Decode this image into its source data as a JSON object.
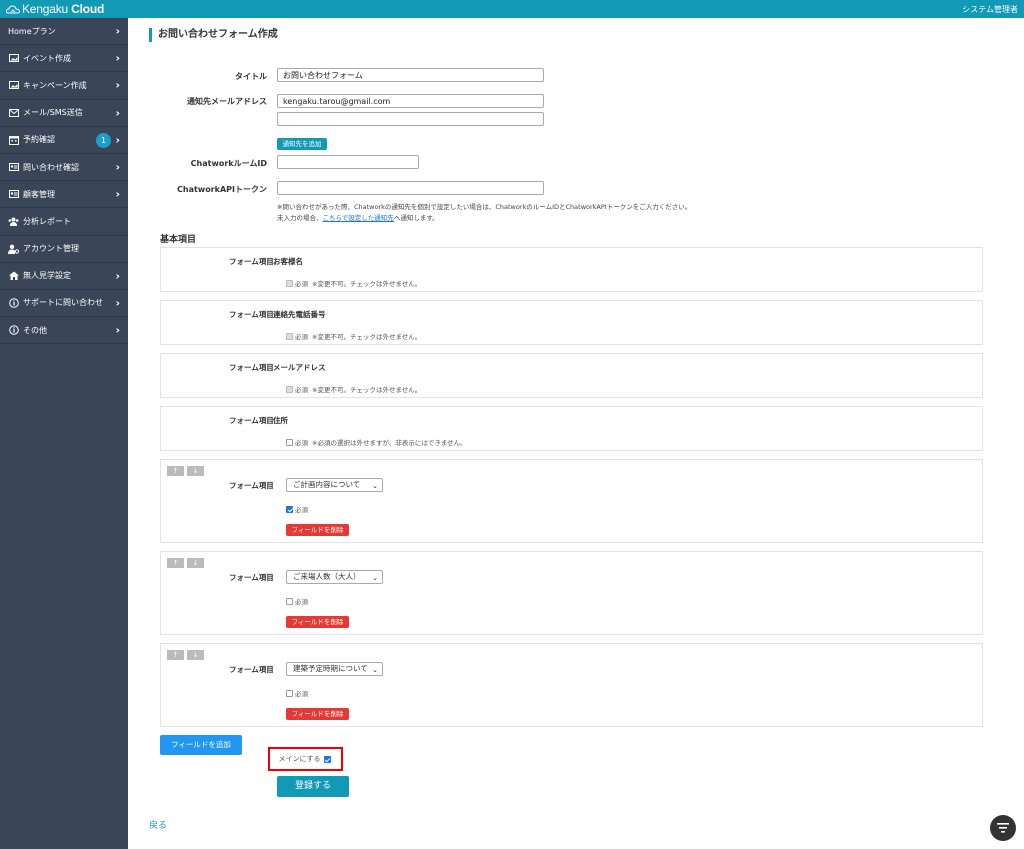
{
  "header": {
    "brand_prefix": "Kengaku",
    "brand_suffix": " Cloud",
    "admin_label": "システム管理者"
  },
  "sidebar": {
    "items": [
      {
        "label": "Homeプラン",
        "icon": "none",
        "chevron": true
      },
      {
        "label": "イベント作成",
        "icon": "image-icon",
        "chevron": true
      },
      {
        "label": "キャンペーン作成",
        "icon": "image-icon",
        "chevron": true
      },
      {
        "label": "メール/SMS送信",
        "icon": "mail-icon",
        "chevron": true
      },
      {
        "label": "予約確認",
        "icon": "calendar-icon",
        "chevron": true,
        "badge": "1"
      },
      {
        "label": "問い合わせ確認",
        "icon": "id-card-icon",
        "chevron": true
      },
      {
        "label": "顧客管理",
        "icon": "id-card-icon",
        "chevron": true
      },
      {
        "label": "分析レポート",
        "icon": "users-icon",
        "chevron": false
      },
      {
        "label": "アカウント管理",
        "icon": "user-gear-icon",
        "chevron": false
      },
      {
        "label": "無人見学設定",
        "icon": "home-icon",
        "chevron": true
      },
      {
        "label": "サポートに問い合わせ",
        "icon": "info-icon",
        "chevron": true
      },
      {
        "label": "その他",
        "icon": "info-icon",
        "chevron": true
      }
    ]
  },
  "page": {
    "title": "お問い合わせフォーム作成"
  },
  "form": {
    "title_label": "タイトル",
    "title_value": "お問い合わせフォーム",
    "email_label": "通知先メールアドレス",
    "email_value_1": "kengaku.tarou@gmail.com",
    "email_value_2": "",
    "add_email_button": "通知先を追加",
    "chatwork_room_label": "ChatworkルームID",
    "chatwork_room_value": "",
    "chatwork_token_label": "ChatworkAPIトークン",
    "chatwork_token_value": "",
    "note_line1": "※問い合わせがあった際、Chatworkの通知先を個別で設定したい場合は、ChatworkのルームIDとChatworkAPIトークンをご入力ください。",
    "note_line2_prefix": "未入力の場合、",
    "note_link": "こちらで設定した通知先",
    "note_line2_suffix": "へ通知します。"
  },
  "basic_section": {
    "label": "基本項目"
  },
  "fixed_fields": [
    {
      "label": "フォーム項目",
      "name": "お客様名",
      "required_text": "必須",
      "note": "※変更不可。チェックは外せません。"
    },
    {
      "label": "フォーム項目",
      "name": "連絡先電話番号",
      "required_text": "必須",
      "note": "※変更不可。チェックは外せません。"
    },
    {
      "label": "フォーム項目",
      "name": "メールアドレス",
      "required_text": "必須",
      "note": "※変更不可。チェックは外せません。"
    },
    {
      "label": "フォーム項目",
      "name": "住所",
      "required_text": "必須",
      "note": "※必須の選択は外せますが、非表示にはできません。"
    }
  ],
  "custom_fields": [
    {
      "label": "フォーム項目",
      "selected": "ご計画内容について",
      "required_text": "必須",
      "required": true,
      "delete_label": "フィールドを削除",
      "up": "↑",
      "down": "↓"
    },
    {
      "label": "フォーム項目",
      "selected": "ご来場人数（大人）",
      "required_text": "必須",
      "required": false,
      "delete_label": "フィールドを削除",
      "up": "↑",
      "down": "↓"
    },
    {
      "label": "フォーム項目",
      "selected": "建築予定時期について",
      "required_text": "必須",
      "required": false,
      "delete_label": "フィールドを削除",
      "up": "↑",
      "down": "↓"
    }
  ],
  "actions": {
    "add_field": "フィールドを追加",
    "main_label": "メインにする",
    "main_checked": true,
    "submit": "登録する",
    "back": "戻る"
  },
  "colors": {
    "brand": "#1199b5",
    "sidebar": "#3a4558",
    "danger": "#e53935",
    "primary": "#2196f3",
    "highlight": "#ee0000"
  }
}
